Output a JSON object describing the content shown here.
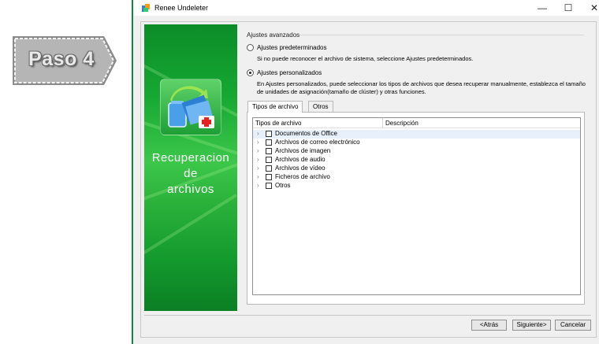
{
  "badge": {
    "label": "Paso 4"
  },
  "window": {
    "title": "Renee Undeleter",
    "controls": {
      "minimize": "—",
      "maximize": "☐",
      "close": "✕"
    }
  },
  "left_panel": {
    "title_lines": [
      "Recuperacion",
      "de",
      "archivos"
    ]
  },
  "settings": {
    "group_label": "Ajustes avanzados",
    "default_option": {
      "label": "Ajustes predeterminados",
      "description": "Si no puede reconocer el archivo de sistema, seleccione Ajustes predeterminados.",
      "checked": false
    },
    "custom_option": {
      "label": "Ajustes personalizados",
      "description": "En Ajustes personalizados, puede seleccionar los tipos de archivos que desea recuperar manualmente, establezca el tamaño de unidades de asignación(tamaño de clúster) y otras funciones.",
      "checked": true
    }
  },
  "tabs": [
    {
      "label": "Tipos de archivo",
      "active": true
    },
    {
      "label": "Otros",
      "active": false
    }
  ],
  "file_list": {
    "columns": [
      "Tipos de archivo",
      "Descripción"
    ],
    "rows": [
      "Documentos de Office",
      "Archivos de correo electrónico",
      "Archivos de imagen",
      "Archivos de audio",
      "Archivos de vídeo",
      "Ficheros de archivo",
      "Otros"
    ]
  },
  "buttons": {
    "back": "<Atrás",
    "next": "Siguiente>",
    "cancel": "Cancelar"
  },
  "colors": {
    "window_frame": "#0f8a3b",
    "panel_green": "#16a833",
    "selected_row": "#e8f1fb"
  }
}
